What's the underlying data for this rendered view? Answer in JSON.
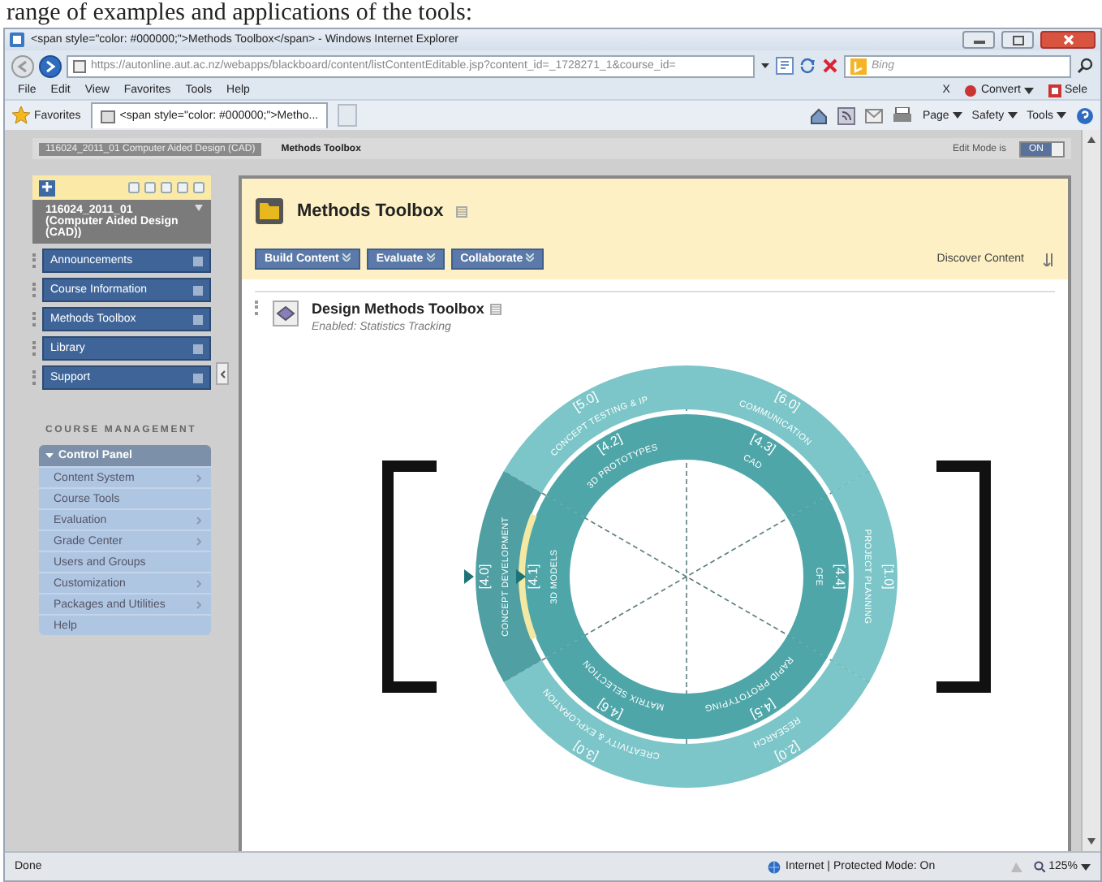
{
  "document_text": "range of examples and applications of the tools:",
  "window": {
    "title": "<span style=\"color: #000000;\">Methods Toolbox</span> - Windows Internet Explorer"
  },
  "address_bar": {
    "url": "https://autonline.aut.ac.nz/webapps/blackboard/content/listContentEditable.jsp?content_id=_1728271_1&course_id=",
    "search_placeholder": "Bing"
  },
  "menu_bar": [
    "File",
    "Edit",
    "View",
    "Favorites",
    "Tools",
    "Help"
  ],
  "toolbar_right": {
    "close": "X",
    "convert": "Convert",
    "select": "Sele"
  },
  "favorites_bar": {
    "favorites": "Favorites",
    "tab": "<span style=\"color: #000000;\">Metho...",
    "commands": [
      "Page",
      "Safety",
      "Tools"
    ]
  },
  "breadcrumbs": [
    {
      "label": "116024_2011_01 Computer Aided Design (CAD)",
      "selected": false
    },
    {
      "label": "Methods Toolbox",
      "selected": true
    }
  ],
  "edit_mode": {
    "label": "Edit Mode is",
    "toggle": "ON",
    "on": true
  },
  "sidebar": {
    "course_title": "116024_2011_01 (Computer Aided Design (CAD))",
    "menu": [
      "Announcements",
      "Course Information",
      "Methods Toolbox",
      "Library",
      "Support"
    ],
    "section_title": "COURSE MANAGEMENT",
    "control_panel": {
      "title": "Control Panel",
      "expanded": true,
      "items": [
        {
          "label": "Content System",
          "submenu": true
        },
        {
          "label": "Course Tools",
          "submenu": false
        },
        {
          "label": "Evaluation",
          "submenu": true
        },
        {
          "label": "Grade Center",
          "submenu": true
        },
        {
          "label": "Users and Groups",
          "submenu": false
        },
        {
          "label": "Customization",
          "submenu": true
        },
        {
          "label": "Packages and Utilities",
          "submenu": true
        },
        {
          "label": "Help",
          "submenu": false
        }
      ]
    }
  },
  "content": {
    "title": "Methods Toolbox",
    "actions": [
      "Build Content",
      "Evaluate",
      "Collaborate"
    ],
    "discover": "Discover Content",
    "item": {
      "title": "Design Methods Toolbox",
      "status": "Enabled: Statistics Tracking"
    },
    "diagram": {
      "outer_segments": [
        {
          "number": "[5.0]",
          "label": "CONCEPT TESTING & IP",
          "selected": false
        },
        {
          "number": "[6.0]",
          "label": "COMMUNICATION",
          "selected": false
        },
        {
          "number": "[4.0]",
          "label": "CONCEPT DEVELOPMENT",
          "selected": true
        },
        {
          "number": "[1.0]",
          "label": "PROJECT PLANNING",
          "selected": false
        },
        {
          "number": "[3.0]",
          "label": "CREATIVITY & EXPLORATION",
          "selected": false
        },
        {
          "number": "[2.0]",
          "label": "RESEARCH",
          "selected": false
        }
      ],
      "inner_segments": [
        {
          "number": "[4.2]",
          "label": "3D PROTOTYPES"
        },
        {
          "number": "[4.3]",
          "label": "CAD"
        },
        {
          "number": "[4.1]",
          "label": "3D MODELS"
        },
        {
          "number": "[4.4]",
          "label": "CFE"
        },
        {
          "number": "[4.6]",
          "label": "MATRIX SELECTION"
        },
        {
          "number": "[4.5]",
          "label": "RAPID PROTOTYPING"
        }
      ]
    }
  },
  "status_bar": {
    "status": "Done",
    "zone": "Internet | Protected Mode: On",
    "zoom": "125%"
  }
}
